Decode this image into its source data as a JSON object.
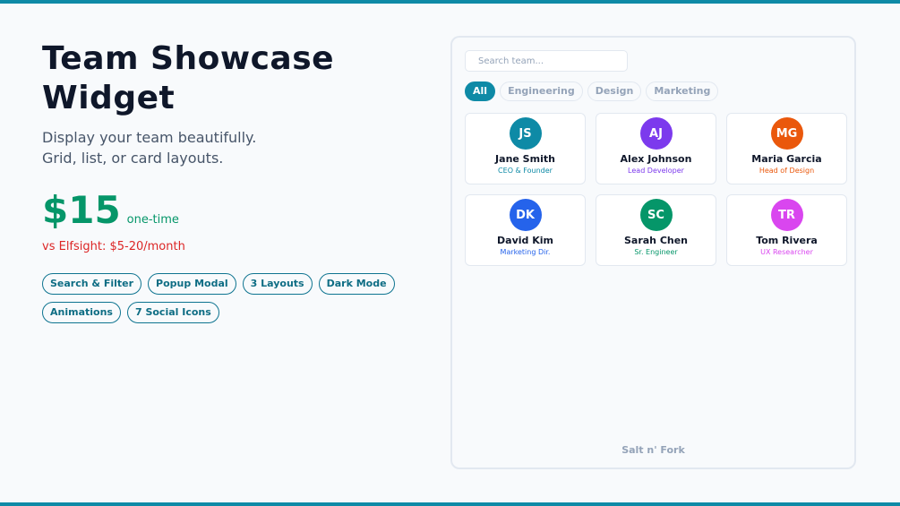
{
  "hero": {
    "title_line1": "Team Showcase",
    "title_line2": "Widget",
    "subtitle_line1": "Display your team beautifully.",
    "subtitle_line2": "Grid, list, or card layouts.",
    "price": "$15",
    "price_note": "one-time",
    "comparison": "vs Elfsight: $5-20/month",
    "features": [
      "Search & Filter",
      "Popup Modal",
      "3 Layouts",
      "Dark Mode",
      "Animations",
      "7 Social Icons"
    ]
  },
  "widget": {
    "search_placeholder": "Search team...",
    "filters": [
      "All",
      "Engineering",
      "Design",
      "Marketing"
    ],
    "active_filter": "All",
    "members": [
      {
        "initials": "JS",
        "name": "Jane Smith",
        "role": "CEO & Founder",
        "color": "#0e8aa6"
      },
      {
        "initials": "AJ",
        "name": "Alex Johnson",
        "role": "Lead Developer",
        "color": "#7c3aed"
      },
      {
        "initials": "MG",
        "name": "Maria Garcia",
        "role": "Head of Design",
        "color": "#ea580c"
      },
      {
        "initials": "DK",
        "name": "David Kim",
        "role": "Marketing Dir.",
        "color": "#2563eb"
      },
      {
        "initials": "SC",
        "name": "Sarah Chen",
        "role": "Sr. Engineer",
        "color": "#059669"
      },
      {
        "initials": "TR",
        "name": "Tom Rivera",
        "role": "UX Researcher",
        "color": "#d946ef"
      }
    ],
    "footer": "Salt n' Fork"
  },
  "colors": {
    "accent": "#0e8aa6",
    "price": "#059669",
    "comparison": "#dc2626"
  }
}
